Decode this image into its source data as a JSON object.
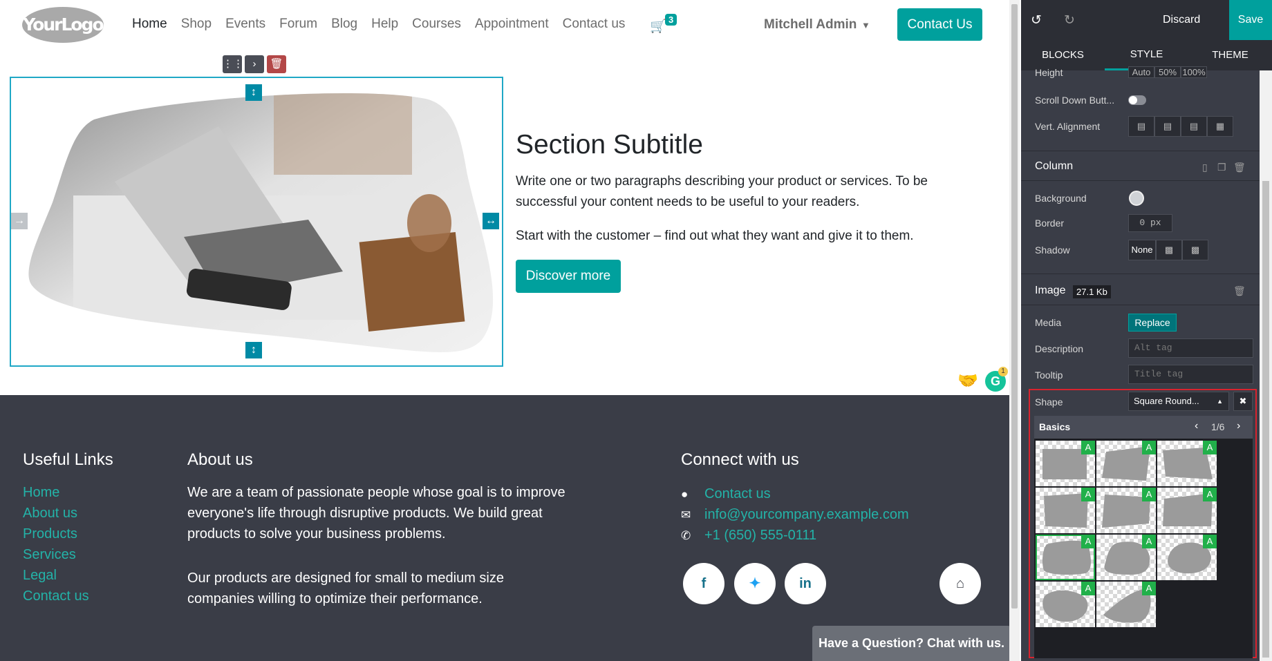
{
  "header": {
    "logo_text": "YourLogo",
    "nav": [
      "Home",
      "Shop",
      "Events",
      "Forum",
      "Blog",
      "Help",
      "Courses",
      "Appointment",
      "Contact us"
    ],
    "cart_count": "3",
    "user": "Mitchell Admin",
    "contact_btn": "Contact Us"
  },
  "section": {
    "subtitle": "Section Subtitle",
    "para1": "Write one or two paragraphs describing your product or services. To be successful your content needs to be useful to your readers.",
    "para2": "Start with the customer – find out what they want and give it to them.",
    "button": "Discover more"
  },
  "footer": {
    "useful_links_title": "Useful Links",
    "useful_links": [
      "Home",
      "About us",
      "Products",
      "Services",
      "Legal",
      "Contact us"
    ],
    "about_title": "About us",
    "about_p1": "We are a team of passionate people whose goal is to improve everyone's life through disruptive products. We build great products to solve your business problems.",
    "about_p2": "Our products are designed for small to medium size companies willing to optimize their performance.",
    "connect_title": "Connect with us",
    "connect_contact": "Contact us",
    "connect_email": "info@yourcompany.example.com",
    "connect_phone": "+1 (650) 555-0111",
    "chat": "Have a Question? Chat with us."
  },
  "panel": {
    "discard": "Discard",
    "save": "Save",
    "tabs": [
      "BLOCKS",
      "STYLE",
      "THEME"
    ],
    "height_label": "Height",
    "height_options": [
      "Auto",
      "50%",
      "100%"
    ],
    "scroll_down_label": "Scroll Down Butt...",
    "vert_align_label": "Vert. Alignment",
    "column_title": "Column",
    "background_label": "Background",
    "border_label": "Border",
    "border_value": "0",
    "border_unit": "px",
    "shadow_label": "Shadow",
    "shadow_value": "None",
    "image_title": "Image",
    "image_size": "27.1 Kb",
    "media_label": "Media",
    "replace_btn": "Replace",
    "description_label": "Description",
    "description_placeholder": "Alt tag",
    "tooltip_label": "Tooltip",
    "tooltip_placeholder": "Title tag",
    "shape_label": "Shape",
    "shape_value": "Square Round...",
    "picker_group": "Basics",
    "picker_page": "1/6",
    "thumb_badge": "A"
  },
  "colors": {
    "accent": "#00a09d",
    "footer_bg": "#3a3d47",
    "link": "#23b3a8",
    "highlight": "#d9232e"
  }
}
